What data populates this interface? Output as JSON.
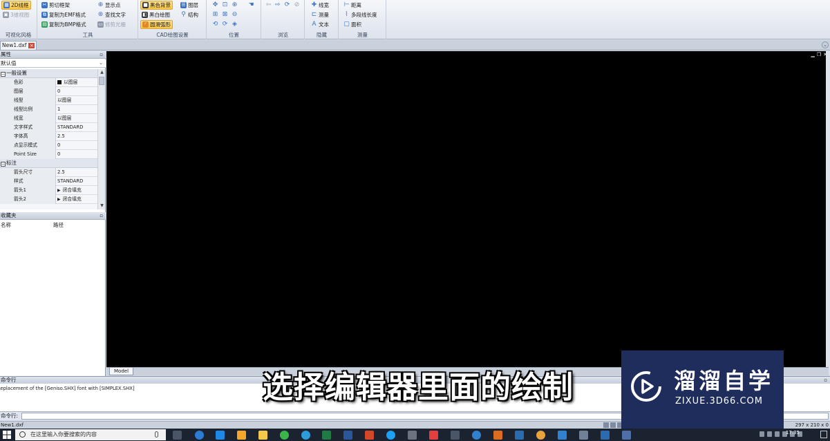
{
  "ribbon": {
    "groups": {
      "visual_style": "可视化风格",
      "tools": "工具",
      "cad_settings": "CAD绘图设置",
      "position": "位置",
      "browse": "浏览",
      "hide": "隐藏",
      "measure": "测量"
    },
    "buttons": {
      "wireframe_2d": "2D线框",
      "view_3d": "3维视图",
      "clip_frame": "剪切框架",
      "copy_emf": "复制为EMF格式",
      "copy_bmp": "复制为BMP格式",
      "show_points": "显示点",
      "find_text": "查找文字",
      "trim_light": "修剪光栅",
      "black_bg": "黑色背景",
      "bw_draw": "黑白绘图",
      "smooth_arc": "圆滑弧形",
      "layers": "图层",
      "structure": "结构",
      "line_width": "线宽",
      "measure_btn": "测量",
      "text": "文本",
      "distance": "距离",
      "polyline_length": "多段线长度",
      "area": "面积"
    }
  },
  "document": {
    "tab": "New1.dxf"
  },
  "properties": {
    "title": "属性",
    "combo": "默认值",
    "categories": {
      "general": "一般设置",
      "dimension": "标注"
    },
    "rows": [
      {
        "key": "色彩",
        "value": "以图层"
      },
      {
        "key": "图层",
        "value": "0"
      },
      {
        "key": "线型",
        "value": "以图层"
      },
      {
        "key": "线型比例",
        "value": "1"
      },
      {
        "key": "线宽",
        "value": "以图层"
      },
      {
        "key": "文字样式",
        "value": "STANDARD"
      },
      {
        "key": "字体高",
        "value": "2.5"
      },
      {
        "key": "点显示模式",
        "value": "0"
      },
      {
        "key": "Point Size",
        "value": "0"
      }
    ],
    "dim_rows": [
      {
        "key": "箭头尺寸",
        "value": "2.5"
      },
      {
        "key": "样式",
        "value": "STANDARD"
      },
      {
        "key": "箭头1",
        "value": "闭合填充"
      },
      {
        "key": "箭头2",
        "value": "闭合填充"
      }
    ]
  },
  "favorites": {
    "title": "收藏夹",
    "col_name": "名称",
    "col_path": "路径"
  },
  "canvas": {
    "model_tab": "Model"
  },
  "command": {
    "title": "命令行",
    "output": "Replacement of the [Geniso.SHX] font with [SIMPLEX.SHX]",
    "input_label": "命令行:",
    "input_value": ""
  },
  "status": {
    "left": "New1.dxf",
    "right": "297 x 210 x 0"
  },
  "subtitle": "选择编辑器里面的绘制",
  "watermark": {
    "title": "溜溜自学",
    "url": "ZIXUE.3D66.COM"
  },
  "taskbar": {
    "search_placeholder": "在这里输入你要搜索的内容",
    "time": "17:35"
  }
}
